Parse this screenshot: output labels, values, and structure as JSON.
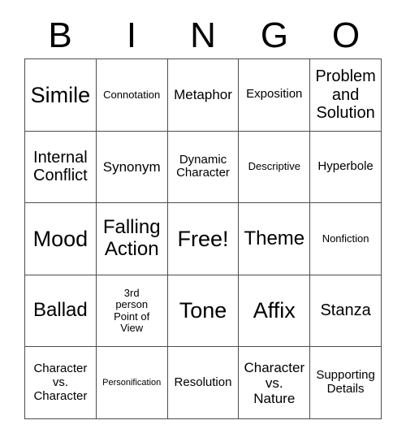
{
  "card": {
    "header_letters": [
      "B",
      "I",
      "N",
      "G",
      "O"
    ],
    "columns": 5,
    "rows": 5,
    "border_color": "#4d4d4d",
    "background_color": "#ffffff",
    "text_color": "#000000",
    "cells": [
      {
        "text": "Simile",
        "size": "xxl"
      },
      {
        "text": "Connotation",
        "size": "xs"
      },
      {
        "text": "Metaphor",
        "size": "md"
      },
      {
        "text": "Exposition",
        "size": "sm"
      },
      {
        "text": "Problem\nand\nSolution",
        "size": "lg"
      },
      {
        "text": "Internal\nConflict",
        "size": "lg"
      },
      {
        "text": "Synonym",
        "size": "md"
      },
      {
        "text": "Dynamic\nCharacter",
        "size": "sm"
      },
      {
        "text": "Descriptive",
        "size": "xs"
      },
      {
        "text": "Hyperbole",
        "size": "sm"
      },
      {
        "text": "Mood",
        "size": "xxl"
      },
      {
        "text": "Falling\nAction",
        "size": "xl"
      },
      {
        "text": "Free!",
        "size": "xxl"
      },
      {
        "text": "Theme",
        "size": "xl"
      },
      {
        "text": "Nonfiction",
        "size": "xs"
      },
      {
        "text": "Ballad",
        "size": "xl"
      },
      {
        "text": "3rd\nperson\nPoint of\nView",
        "size": "xs"
      },
      {
        "text": "Tone",
        "size": "xxl"
      },
      {
        "text": "Affix",
        "size": "xxl"
      },
      {
        "text": "Stanza",
        "size": "lg"
      },
      {
        "text": "Character\nvs.\nCharacter",
        "size": "sm"
      },
      {
        "text": "Personification",
        "size": "xxs"
      },
      {
        "text": "Resolution",
        "size": "sm"
      },
      {
        "text": "Character\nvs.\nNature",
        "size": "md"
      },
      {
        "text": "Supporting\nDetails",
        "size": "sm"
      }
    ]
  }
}
